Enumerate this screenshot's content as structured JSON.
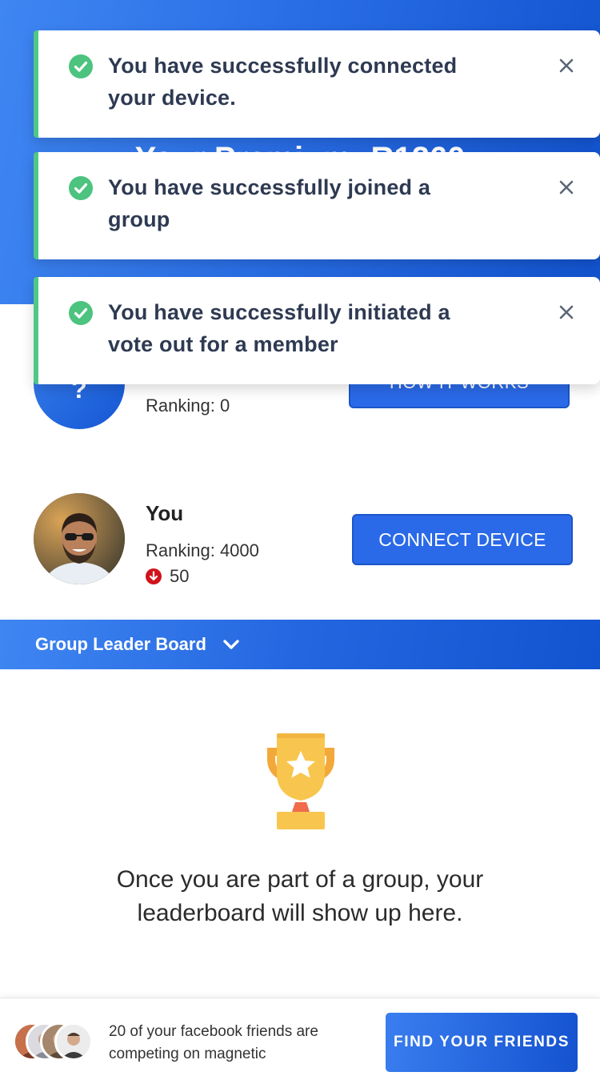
{
  "colors": {
    "brand_blue": "#2a6ae8",
    "toast_accent": "#4fc886",
    "trophy_gold": "#f7c24b",
    "down_red": "#d0121b"
  },
  "hero": {
    "title": "Your Premium: R1260"
  },
  "toasts": [
    {
      "message": "You have successfully connected your device.",
      "icon": "check-circle-icon",
      "close_icon": "close-icon"
    },
    {
      "message": "You have successfully joined a group",
      "icon": "check-circle-icon",
      "close_icon": "close-icon"
    },
    {
      "message": "You have successfully initiated a vote out for a member",
      "icon": "check-circle-icon",
      "close_icon": "close-icon"
    }
  ],
  "members": [
    {
      "avatar_text": "?",
      "ranking": "Ranking: 0",
      "button": "HOW IT WORKS"
    },
    {
      "name": "You",
      "ranking": "Ranking: 4000",
      "delta": "50",
      "delta_icon": "arrow-down-circle-icon",
      "button": "CONNECT DEVICE"
    }
  ],
  "leaderboard": {
    "title": "Group Leader Board",
    "toggle_icon": "chevron-down-icon",
    "empty_icon": "trophy-icon",
    "empty_message": "Once you are part of a group, your leaderboard will show up here."
  },
  "footer": {
    "friends_text": "20 of your facebook friends are competing on magnetic",
    "button": "FIND YOUR FRIENDS"
  }
}
